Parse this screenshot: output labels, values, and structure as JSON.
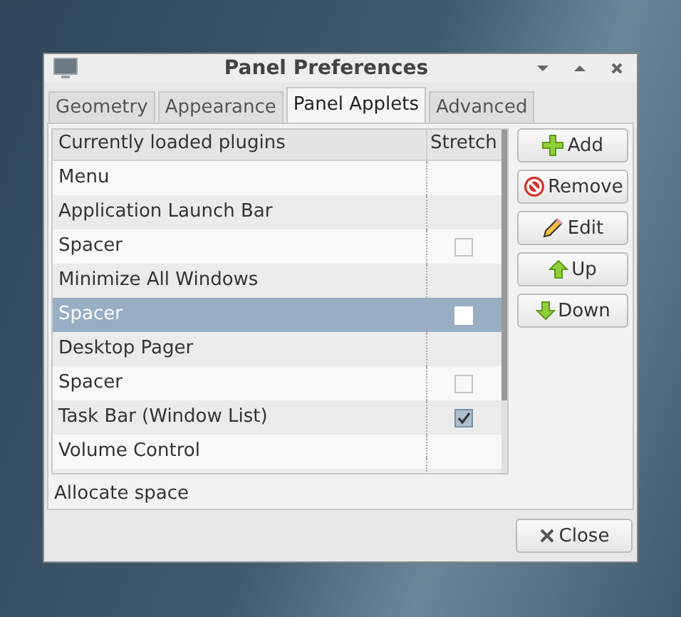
{
  "window": {
    "title": "Panel Preferences"
  },
  "tabs": [
    {
      "label": "Geometry",
      "selected": false
    },
    {
      "label": "Appearance",
      "selected": false
    },
    {
      "label": "Panel Applets",
      "selected": true
    },
    {
      "label": "Advanced",
      "selected": false
    }
  ],
  "table": {
    "columns": [
      "Currently loaded plugins",
      "Stretch"
    ],
    "rows": [
      {
        "name": "Menu",
        "selected": false
      },
      {
        "name": "Application Launch Bar",
        "selected": false
      },
      {
        "name": "Spacer",
        "selected": false,
        "checked": false
      },
      {
        "name": "Minimize All Windows",
        "selected": false
      },
      {
        "name": "Spacer",
        "selected": true,
        "checked": false
      },
      {
        "name": "Desktop Pager",
        "selected": false
      },
      {
        "name": "Spacer",
        "selected": false,
        "checked": false
      },
      {
        "name": "Task Bar (Window List)",
        "selected": false,
        "checked": true
      },
      {
        "name": "Volume Control",
        "selected": false
      }
    ]
  },
  "buttons": [
    {
      "label": "Add",
      "kind": "add"
    },
    {
      "label": "Remove",
      "kind": "remove"
    },
    {
      "label": "Edit",
      "kind": "edit"
    },
    {
      "label": "Up",
      "kind": "up"
    },
    {
      "label": "Down",
      "kind": "down"
    }
  ],
  "status": "Allocate space",
  "close_button": {
    "label": "Close"
  }
}
